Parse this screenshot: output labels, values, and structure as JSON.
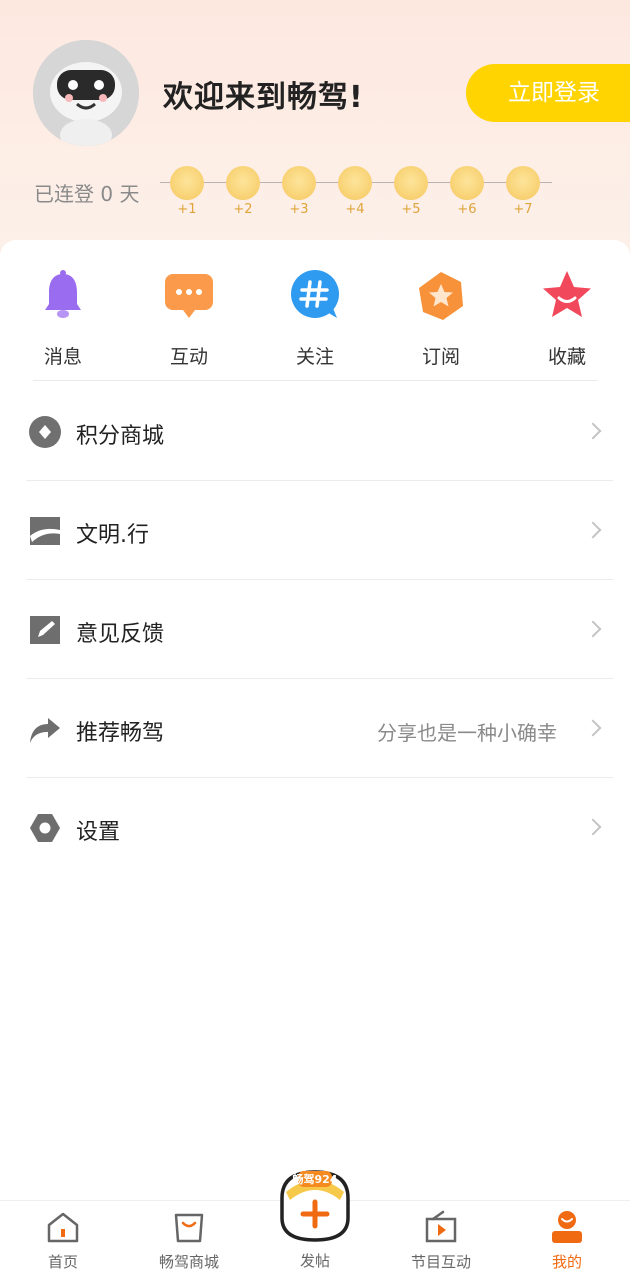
{
  "header": {
    "welcome": "欢迎来到畅驾!",
    "login_label": "立即登录",
    "streak_label": "已连登 0 天",
    "checkin_bonuses": [
      "+1",
      "+2",
      "+3",
      "+4",
      "+5",
      "+6",
      "+7"
    ]
  },
  "quick_actions": [
    {
      "label": "消息",
      "icon": "bell-icon"
    },
    {
      "label": "互动",
      "icon": "chat-bubble-icon"
    },
    {
      "label": "关注",
      "icon": "hashtag-icon"
    },
    {
      "label": "订阅",
      "icon": "subscribe-star-icon"
    },
    {
      "label": "收藏",
      "icon": "favorite-star-icon"
    }
  ],
  "menu": [
    {
      "label": "积分商城",
      "sub": "",
      "icon": "points-icon"
    },
    {
      "label": "文明.行",
      "sub": "",
      "icon": "road-icon"
    },
    {
      "label": "意见反馈",
      "sub": "",
      "icon": "edit-icon"
    },
    {
      "label": "推荐畅驾",
      "sub": "分享也是一种小确幸",
      "icon": "share-icon"
    },
    {
      "label": "设置",
      "sub": "",
      "icon": "settings-icon"
    }
  ],
  "tabbar": {
    "tabs": [
      {
        "label": "首页",
        "icon": "home-icon"
      },
      {
        "label": "畅驾商城",
        "icon": "shop-bag-icon"
      },
      {
        "label": "发帖",
        "icon": "post-plus-icon"
      },
      {
        "label": "节目互动",
        "icon": "radio-play-icon"
      },
      {
        "label": "我的",
        "icon": "profile-icon"
      }
    ],
    "active_index": 4,
    "post_badge": "畅驾924"
  },
  "colors": {
    "accent": "#ffd400",
    "active_tab": "#f06a12",
    "header_bg": "#fde8e0"
  }
}
